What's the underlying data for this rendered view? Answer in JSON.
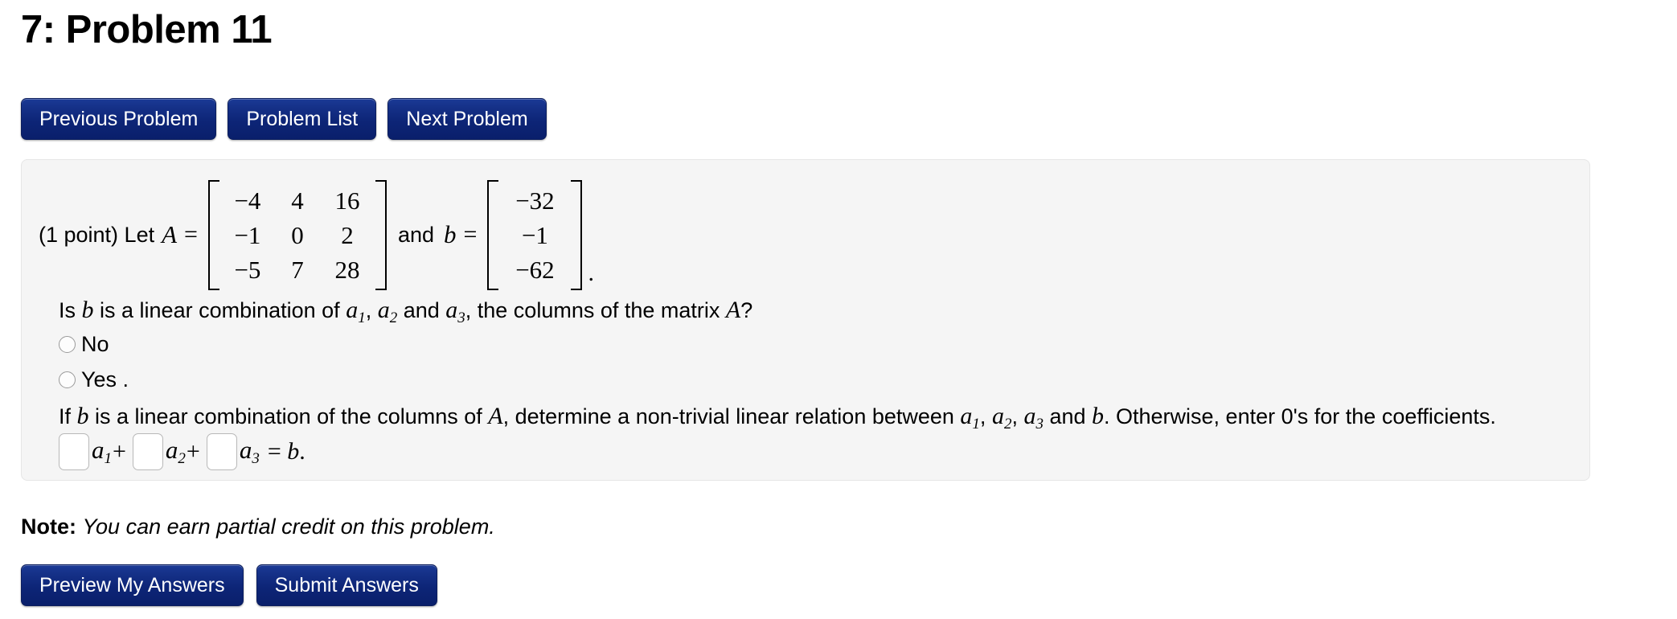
{
  "page": {
    "title": "7: Problem 11"
  },
  "nav": {
    "buttons": [
      {
        "label": "Previous Problem",
        "name": "previous-problem-button"
      },
      {
        "label": "Problem List",
        "name": "problem-list-button"
      },
      {
        "label": "Next Problem",
        "name": "next-problem-button"
      }
    ]
  },
  "problem": {
    "points_text": "(1 point) Let",
    "matrix_A": {
      "symbol": "A",
      "rows": [
        [
          "−4",
          "4",
          "16"
        ],
        [
          "−1",
          "0",
          "2"
        ],
        [
          "−5",
          "7",
          "28"
        ]
      ]
    },
    "conjunction": "and",
    "vector_b": {
      "symbol": "b",
      "rows": [
        [
          "−32"
        ],
        [
          "−1"
        ],
        [
          "−62"
        ]
      ]
    },
    "trailing_period": ".",
    "question": {
      "part1": "Is ",
      "var_b": "b",
      "part2": " is a linear combination of ",
      "a1": "a",
      "a1_sub": "1",
      "comma1": ", ",
      "a2": "a",
      "a2_sub": "2",
      "part3": " and ",
      "a3": "a",
      "a3_sub": "3",
      "part4": ", the columns of the matrix ",
      "var_A": "A",
      "part5": "?"
    },
    "options": [
      {
        "label": "No",
        "selected": false,
        "name": "radio-option-no"
      },
      {
        "label": "Yes .",
        "selected": false,
        "name": "radio-option-yes"
      }
    ],
    "instruction": {
      "part1": "If ",
      "var_b1": "b",
      "part2": " is a linear combination of the columns of ",
      "var_A": "A",
      "part3": ", determine a non-trivial linear relation between ",
      "a1": "a",
      "a1_sub": "1",
      "comma1": ", ",
      "a2": "a",
      "a2_sub": "2",
      "comma2": ", ",
      "a3": "a",
      "a3_sub": "3",
      "part4": " and ",
      "var_b2": "b",
      "part5": ". Otherwise, enter 0's for the coefficients."
    },
    "answer_row": {
      "coef1_value": "",
      "coef1_label": "a",
      "coef1_sub": "1",
      "plus1": "+",
      "coef2_value": "",
      "coef2_label": "a",
      "coef2_sub": "2",
      "plus2": "+",
      "coef3_value": "",
      "coef3_label": "a",
      "coef3_sub": "3",
      "tail_eq": "=",
      "tail_b": "b",
      "tail_period": "."
    }
  },
  "note": {
    "label": "Note:",
    "text": "You can earn partial credit on this problem."
  },
  "actions": {
    "buttons": [
      {
        "label": "Preview My Answers",
        "name": "preview-my-answers-button"
      },
      {
        "label": "Submit Answers",
        "name": "submit-answers-button"
      }
    ]
  },
  "colors": {
    "button_blue": "#0d2577",
    "panel_bg": "#f5f5f5",
    "panel_border": "#e6e6e6",
    "page_bg": "#ffffff"
  }
}
